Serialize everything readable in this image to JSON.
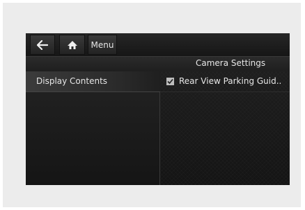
{
  "toolbar": {
    "back_icon": "back-arrow-icon",
    "home_icon": "home-icon",
    "menu_label": "Menu"
  },
  "header": {
    "title": "Camera Settings"
  },
  "sidebar": {
    "items": [
      {
        "label": "Display Contents",
        "selected": true
      }
    ]
  },
  "main": {
    "options": [
      {
        "label": "Rear View Parking Guid..",
        "checked": true
      }
    ]
  }
}
